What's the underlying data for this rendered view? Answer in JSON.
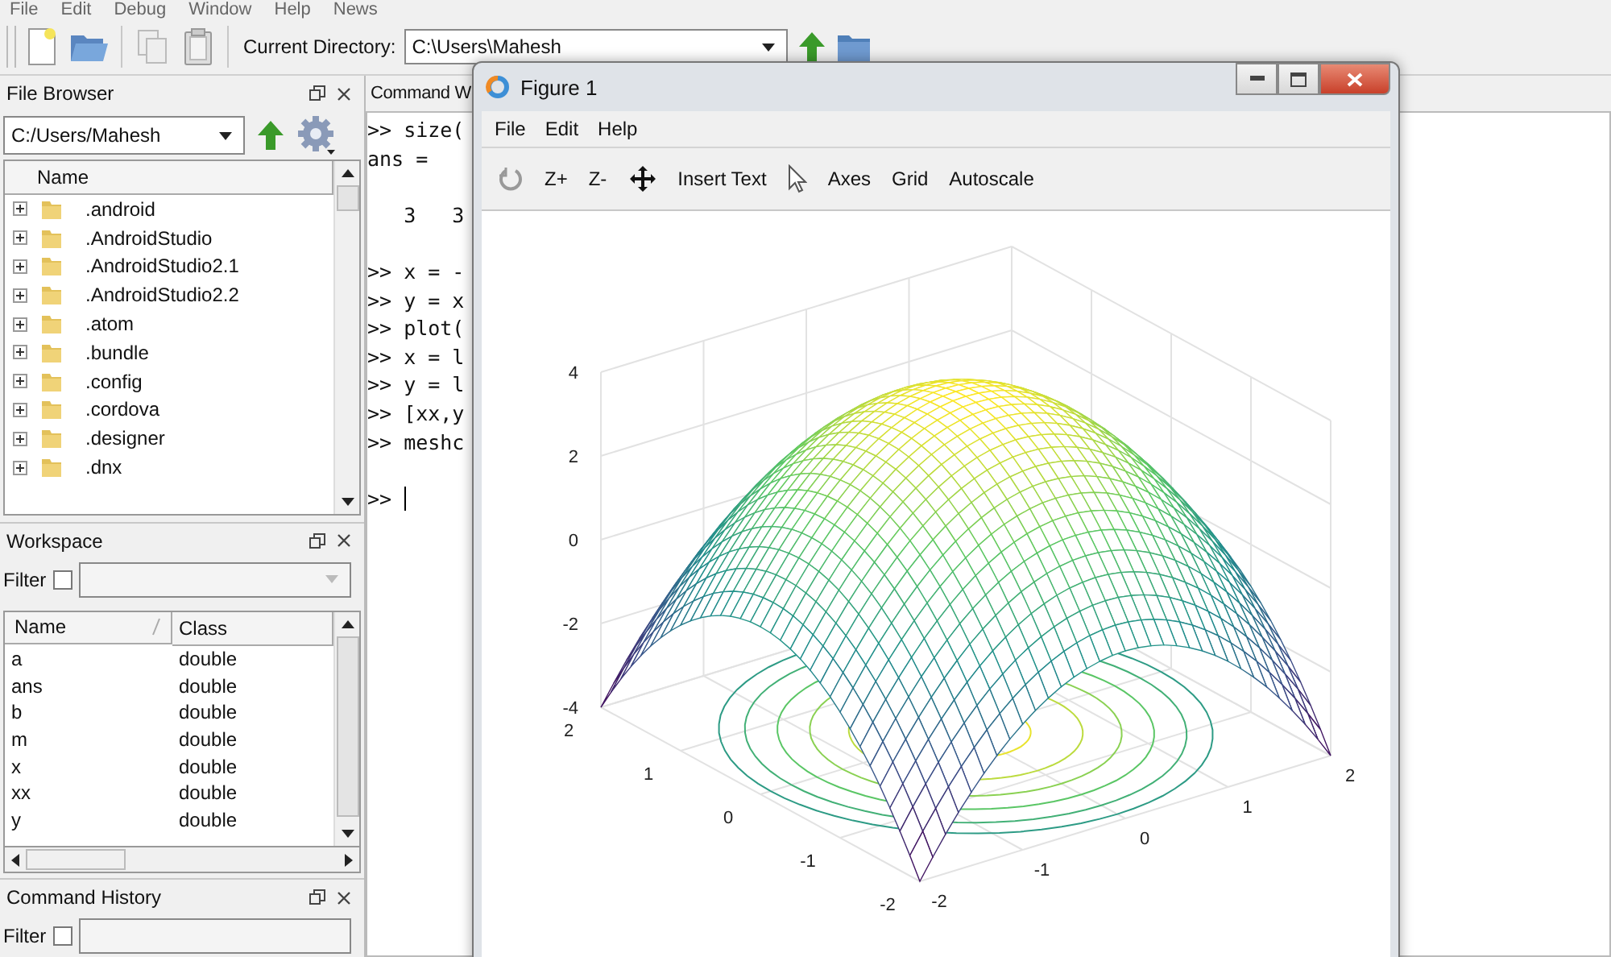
{
  "menubar": [
    "File",
    "Edit",
    "Debug",
    "Window",
    "Help",
    "News"
  ],
  "toolbar": {
    "current_directory_label": "Current Directory:",
    "current_directory": "C:\\Users\\Mahesh"
  },
  "file_browser": {
    "title": "File Browser",
    "path": "C:/Users/Mahesh",
    "column": "Name",
    "items": [
      ".android",
      ".AndroidStudio",
      ".AndroidStudio2.1",
      ".AndroidStudio2.2",
      ".atom",
      ".bundle",
      ".config",
      ".cordova",
      ".designer",
      ".dnx"
    ]
  },
  "workspace": {
    "title": "Workspace",
    "filter_label": "Filter",
    "filter_checked": false,
    "columns": [
      "Name",
      "Class"
    ],
    "rows": [
      {
        "name": "a",
        "class": "double"
      },
      {
        "name": "ans",
        "class": "double"
      },
      {
        "name": "b",
        "class": "double"
      },
      {
        "name": "m",
        "class": "double"
      },
      {
        "name": "x",
        "class": "double"
      },
      {
        "name": "xx",
        "class": "double"
      },
      {
        "name": "y",
        "class": "double"
      }
    ]
  },
  "command_history": {
    "title": "Command History",
    "filter_label": "Filter",
    "filter_checked": false
  },
  "command_window": {
    "title": "Command W",
    "blocks": [
      {
        "lines": [
          ">> size(",
          "ans ="
        ]
      },
      {
        "lines": [
          "   3   3"
        ]
      },
      {
        "lines": [
          ">> x = -",
          ">> y = x",
          ">> plot(",
          ">> x = l",
          ">> y = l",
          ">> [xx,y",
          ">> meshc"
        ]
      }
    ],
    "prompt": ">>"
  },
  "figure": {
    "title": "Figure 1",
    "menu": [
      "File",
      "Edit",
      "Help"
    ],
    "toolbar": [
      {
        "kind": "rotate"
      },
      {
        "kind": "text",
        "label": "Z+"
      },
      {
        "kind": "text",
        "label": "Z-"
      },
      {
        "kind": "pan"
      },
      {
        "kind": "text",
        "label": "Insert Text"
      },
      {
        "kind": "pointer"
      },
      {
        "kind": "text",
        "label": "Axes"
      },
      {
        "kind": "text",
        "label": "Grid"
      },
      {
        "kind": "text",
        "label": "Autoscale"
      }
    ],
    "plot": {
      "z_ticks": [
        "4",
        "2",
        "0",
        "-2",
        "-4"
      ],
      "y_ticks": [
        "2",
        "1",
        "0",
        "-1",
        "-2"
      ],
      "x_ticks": [
        "-2",
        "-1",
        "0",
        "1",
        "2"
      ]
    }
  }
}
